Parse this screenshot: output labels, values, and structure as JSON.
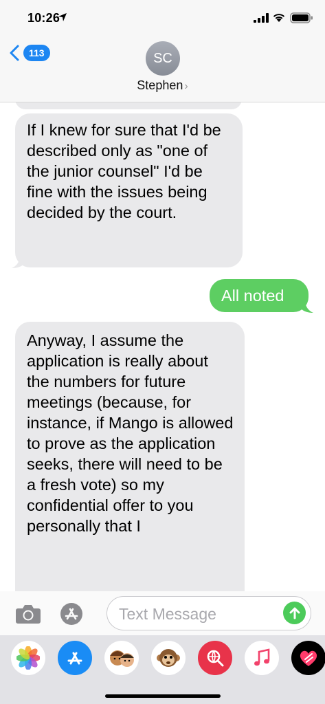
{
  "status_bar": {
    "time": "10:26"
  },
  "header": {
    "back_count": "113",
    "avatar_initials": "SC",
    "contact_name": "Stephen"
  },
  "messages": [
    {
      "direction": "incoming",
      "text": "If I knew for sure that I'd be described only as \"one of the junior counsel\" I'd be fine with the issues being decided by the court."
    },
    {
      "direction": "outgoing",
      "text": "All noted"
    },
    {
      "direction": "incoming",
      "text": "Anyway, I assume the application is really about the numbers for future meetings (because, for instance, if Mango is allowed to prove as the application seeks, there will need to be a fresh vote) so my confidential offer to you personally that I"
    }
  ],
  "composer": {
    "placeholder": "Text Message"
  },
  "dock": {
    "apps": [
      "photos-icon",
      "app-store-icon",
      "memoji-icon",
      "animoji-icon",
      "web-search-icon",
      "music-icon",
      "digital-touch-icon"
    ]
  }
}
